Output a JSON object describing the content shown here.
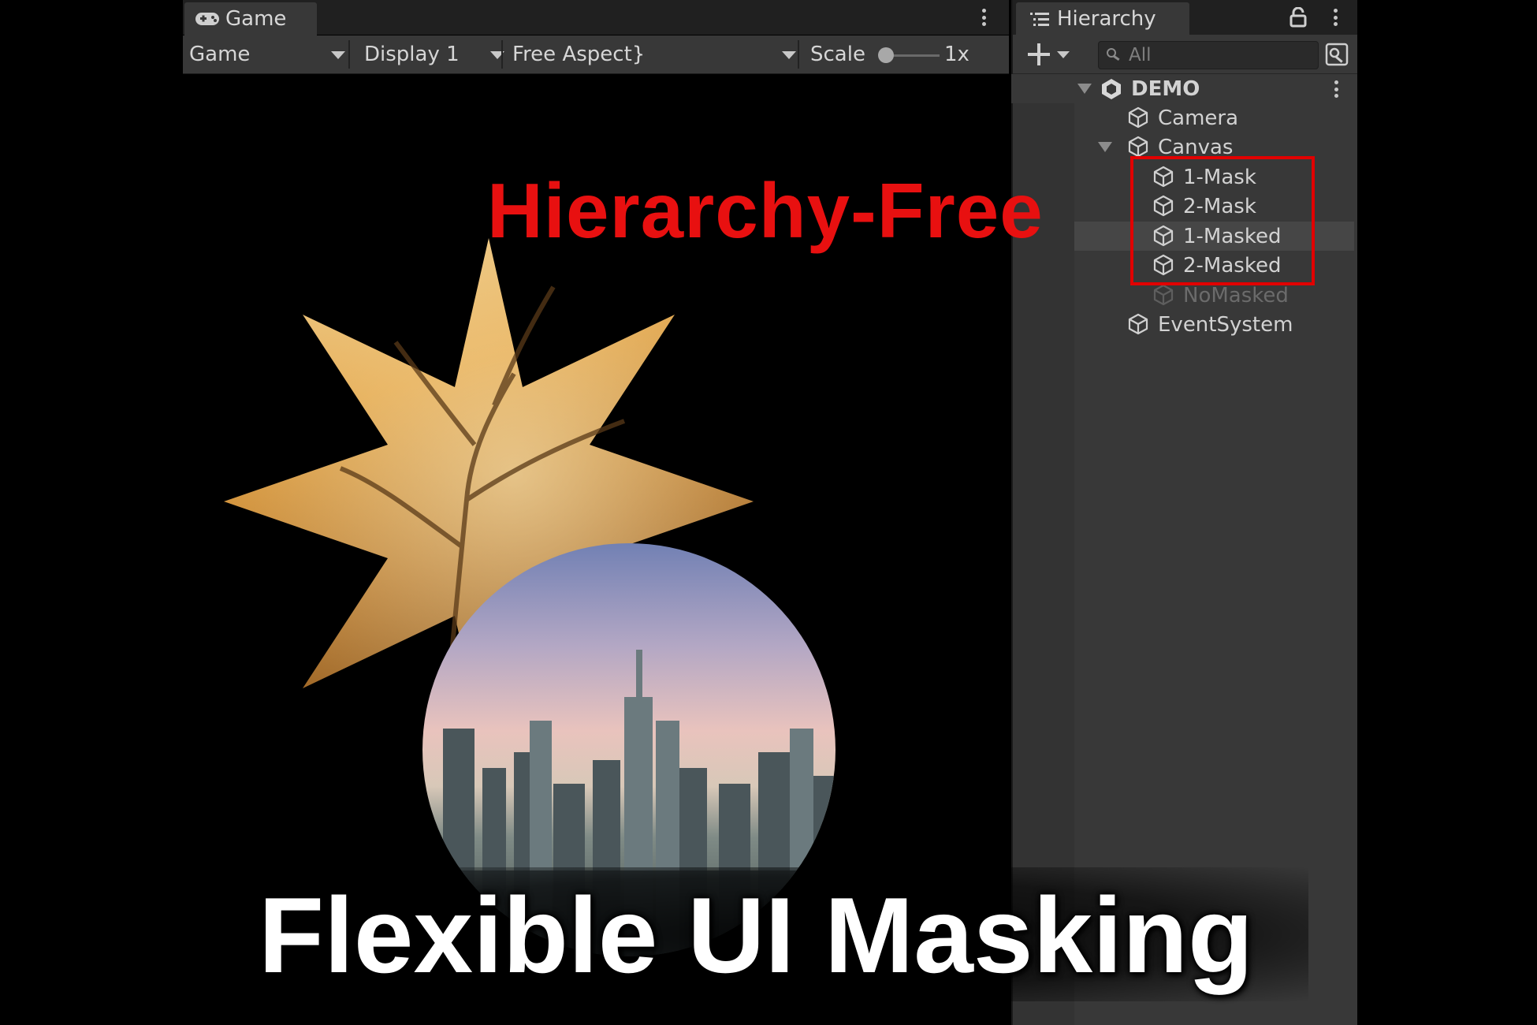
{
  "game_panel": {
    "tab_label": "Game",
    "toolbar": {
      "mode": "Game",
      "display": "Display 1",
      "aspect": "Free Aspect",
      "scale_label": "Scale",
      "scale_value": "1x"
    }
  },
  "hierarchy_panel": {
    "tab_label": "Hierarchy",
    "search_placeholder": "All",
    "scene": "DEMO",
    "items": [
      {
        "label": "Camera"
      },
      {
        "label": "Canvas"
      },
      {
        "label": "1-Mask"
      },
      {
        "label": "2-Mask"
      },
      {
        "label": "1-Masked"
      },
      {
        "label": "2-Masked"
      },
      {
        "label": "NoMasked"
      },
      {
        "label": "EventSystem"
      }
    ]
  },
  "overlay": {
    "hierarchy_free": "Hierarchy-Free",
    "main_title": "Flexible UI Masking"
  },
  "colors": {
    "highlight": "#e10000",
    "panel": "#383838",
    "tabbar": "#202020"
  }
}
